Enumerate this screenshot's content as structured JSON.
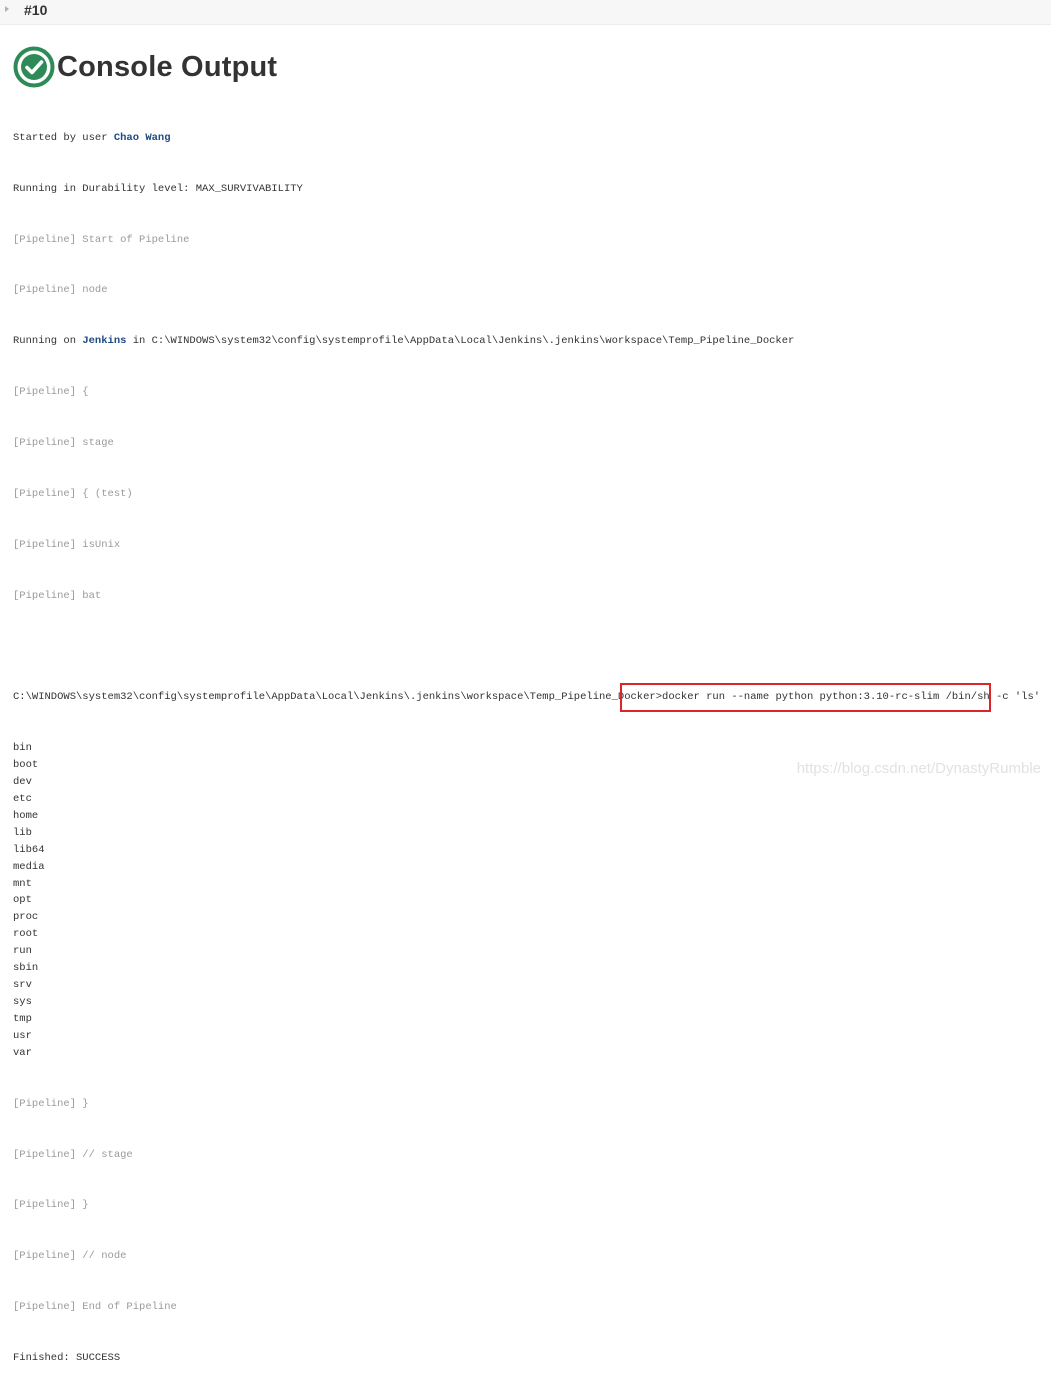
{
  "breadcrumb": {
    "build": "#10"
  },
  "status_icon": "success-check-icon",
  "page": {
    "title": "Console Output"
  },
  "console": {
    "started_prefix": "Started by user ",
    "user": "Chao Wang",
    "durability": "Running in Durability level: MAX_SURVIVABILITY",
    "pipeline_start": "[Pipeline] Start of Pipeline",
    "pipeline_node": "[Pipeline] node",
    "running_prefix": "Running on ",
    "node_name": "Jenkins",
    "running_suffix": " in C:\\WINDOWS\\system32\\config\\systemprofile\\AppData\\Local\\Jenkins\\.jenkins\\workspace\\Temp_Pipeline_Docker",
    "pipeline_open": "[Pipeline] {",
    "pipeline_stage": "[Pipeline] stage",
    "pipeline_test": "[Pipeline] { (test)",
    "pipeline_isunix": "[Pipeline] isUnix",
    "pipeline_bat": "[Pipeline] bat",
    "cmd_path": "C:\\WINDOWS\\system32\\config\\systemprofile\\AppData\\Local\\Jenkins\\.jenkins\\workspace\\Temp_Pipeline_Docker",
    "cmd": ">docker run --name python python:3.10-rc-slim /bin/sh -c 'ls'",
    "ls_output": [
      "bin",
      "boot",
      "dev",
      "etc",
      "home",
      "lib",
      "lib64",
      "media",
      "mnt",
      "opt",
      "proc",
      "root",
      "run",
      "sbin",
      "srv",
      "sys",
      "tmp",
      "usr",
      "var"
    ],
    "pipeline_close_1": "[Pipeline] }",
    "pipeline_end_stage": "[Pipeline] // stage",
    "pipeline_close_2": "[Pipeline] }",
    "pipeline_end_node": "[Pipeline] // node",
    "pipeline_end": "[Pipeline] End of Pipeline",
    "finished": "Finished: SUCCESS"
  },
  "watermark": "https://blog.csdn.net/DynastyRumble",
  "colors": {
    "success": "#2e8b57",
    "link": "#204a87",
    "pipeline_text": "#9a9a9a",
    "highlight_border": "#d9252b"
  }
}
